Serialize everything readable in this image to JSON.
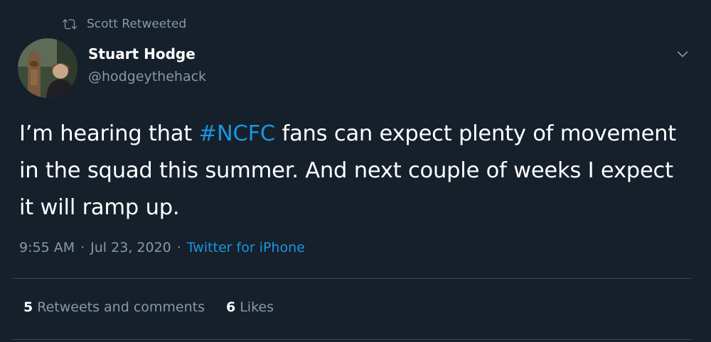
{
  "retweet": {
    "icon": "retweet-icon",
    "text": "Scott Retweeted"
  },
  "author": {
    "name": "Stuart Hodge",
    "handle": "@hodgeythehack",
    "avatar": "profile-photo"
  },
  "tweet": {
    "text_before": "I’m hearing that ",
    "hashtag": "#NCFC",
    "text_after": " fans can expect plenty of movement in the squad this summer. And next couple of weeks I expect it will ramp up."
  },
  "meta": {
    "time": "9:55 AM",
    "separator": "·",
    "date": "Jul 23, 2020",
    "source": "Twitter for iPhone"
  },
  "stats": {
    "retweets_count": "5",
    "retweets_label": "Retweets and comments",
    "likes_count": "6",
    "likes_label": "Likes"
  },
  "colors": {
    "background": "#15202b",
    "secondary_text": "#8899a6",
    "link": "#1b95e0",
    "divider": "#38444d"
  }
}
